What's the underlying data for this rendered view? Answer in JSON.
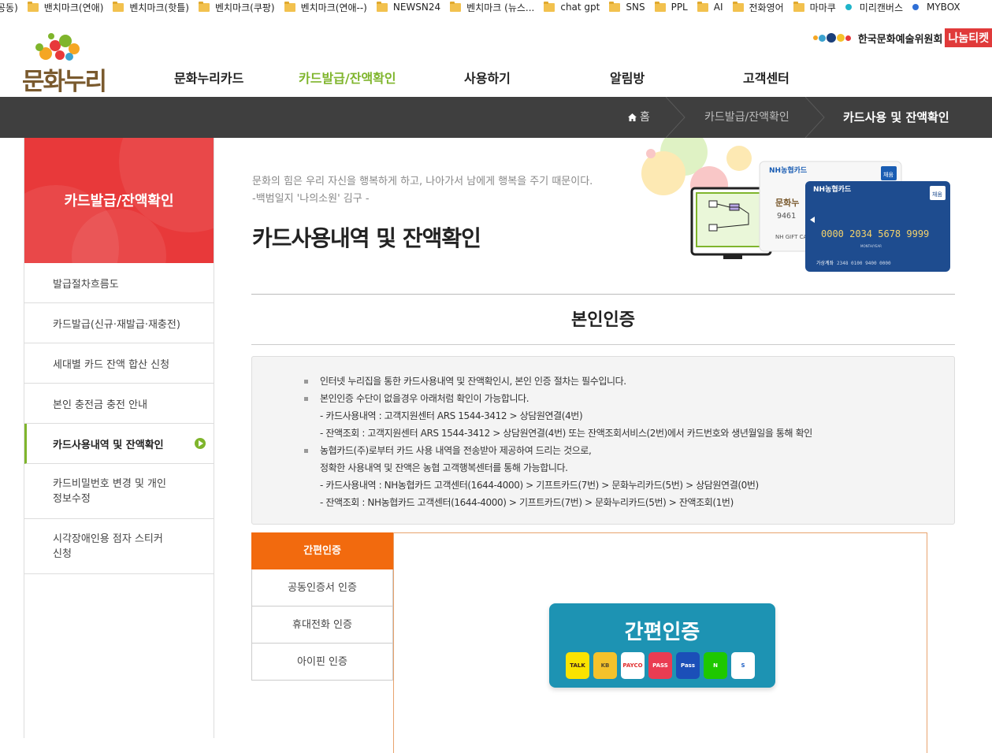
{
  "bookmarks": [
    {
      "label": "공동)",
      "type": "text"
    },
    {
      "label": "밴치마크(연애)",
      "type": "folder"
    },
    {
      "label": "벤치마크(핫틀)",
      "type": "folder"
    },
    {
      "label": "벤치마크(쿠팡)",
      "type": "folder"
    },
    {
      "label": "벤치마크(연애--)",
      "type": "folder"
    },
    {
      "label": "NEWSN24",
      "type": "folder"
    },
    {
      "label": "벤치마크 (뉴스...",
      "type": "folder"
    },
    {
      "label": "chat gpt",
      "type": "folder"
    },
    {
      "label": "SNS",
      "type": "folder"
    },
    {
      "label": "PPL",
      "type": "folder"
    },
    {
      "label": "AI",
      "type": "folder"
    },
    {
      "label": "전화영어",
      "type": "folder"
    },
    {
      "label": "마마쿠",
      "type": "folder"
    },
    {
      "label": "미리캔버스",
      "type": "dot",
      "color": "#1fb4c9"
    },
    {
      "label": "MYBOX",
      "type": "dot",
      "color": "#2f6fd6"
    }
  ],
  "header": {
    "logo_text": "문화누리",
    "org_name": "한국문화예술위원회",
    "org_badge": "나눔티켓",
    "nav": [
      "문화누리카드",
      "카드발급/잔액확인",
      "사용하기",
      "알림방",
      "고객센터"
    ],
    "active_nav": 1
  },
  "breadcrumb": {
    "home": "홈",
    "level1": "카드발급/잔액확인",
    "current": "카드사용 및 잔액확인"
  },
  "sidebar": {
    "title": "카드발급/잔액확인",
    "items": [
      {
        "label": "발급절차흐름도"
      },
      {
        "label": "카드발급(신규·재발급·재충전)"
      },
      {
        "label": "세대별 카드 잔액 합산 신청"
      },
      {
        "label": "본인 충전금 충전 안내"
      },
      {
        "label": "카드사용내역 및 잔액확인",
        "active": true
      },
      {
        "label1": "카드비밀번호 변경 및 개인",
        "label2": "정보수정"
      },
      {
        "label1": "시각장애인용 점자 스티커",
        "label2": "신청"
      }
    ]
  },
  "content": {
    "quote_line1": "문화의 힘은 우리 자신을 행복하게 하고, 나아가서 남에게 행복을 주기 때문이다.",
    "quote_line2": "-백범일지 '나의소원' 김구 -",
    "page_title": "카드사용내역 및 잔액확인",
    "section_title": "본인인증",
    "hero": {
      "card_brand": "NH농협카드",
      "card_number": "0000 2034 5678 9999",
      "card_number_partial": "9461",
      "card_label": "NH GIFT CA",
      "chip_label": "채움",
      "card_logo": "문화누",
      "month_year": "MONTH/YEAR",
      "account_label": "가상계좌",
      "account_number": "2348 0100 9400 0000"
    },
    "info_lines": [
      {
        "text": "인터넷 누리집을 통한 카드사용내역 및 잔액확인시, 본인 인증 절차는 필수입니다.",
        "bullet": true
      },
      {
        "text": "본인인증 수단이 없을경우 아래처럼 확인이 가능합니다.",
        "bullet": true
      },
      {
        "text": "- 카드사용내역 : 고객지원센터 ARS 1544-3412 > 상담원연결(4번)",
        "bullet": false
      },
      {
        "text": "- 잔액조회 : 고객지원센터 ARS 1544-3412 > 상담원연결(4번) 또는 잔액조회서비스(2번)에서 카드번호와 생년월일을 통해 확인",
        "bullet": false
      },
      {
        "text": "농협카드(주)로부터 카드 사용 내역을 전송받아 제공하여 드리는 것으로,",
        "bullet": true
      },
      {
        "text": "정확한 사용내역 및 잔액은 농협 고객행복센터를 통해 가능합니다.",
        "bullet": false
      },
      {
        "text": "- 카드사용내역 : NH농협카드 고객센터(1644-4000) > 기프트카드(7번) > 문화누리카드(5번) > 상담원연결(0번)",
        "bullet": false
      },
      {
        "text": "- 잔액조회 : NH농협카드 고객센터(1644-4000) > 기프트카드(7번) > 문화누리카드(5번) > 잔액조회(1번)",
        "bullet": false
      }
    ],
    "auth_tabs": [
      "간편인증",
      "공동인증서 인증",
      "휴대전화 인증",
      "아이핀 인증"
    ],
    "easy_auth": {
      "title": "간편인증",
      "providers": [
        {
          "name": "TALK",
          "bg": "#fbe300",
          "fg": "#3a1d1d"
        },
        {
          "name": "KB",
          "bg": "#f5c22b",
          "fg": "#5a4a2a"
        },
        {
          "name": "PAYCO",
          "bg": "#ffffff",
          "fg": "#e02e2e"
        },
        {
          "name": "PASS",
          "bg": "#ea3c52",
          "fg": "#ffffff"
        },
        {
          "name": "Pass",
          "bg": "#1b4fb8",
          "fg": "#ffffff"
        },
        {
          "name": "N",
          "bg": "#1ec800",
          "fg": "#ffffff"
        },
        {
          "name": "S",
          "bg": "#ffffff",
          "fg": "#1d5fc4"
        }
      ]
    }
  }
}
